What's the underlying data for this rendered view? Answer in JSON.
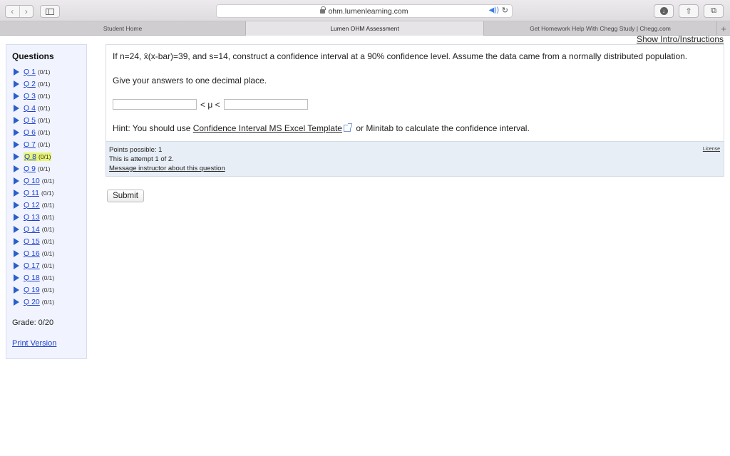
{
  "browser": {
    "url": "ohm.lumenlearning.com",
    "back_glyph": "‹",
    "forward_glyph": "›",
    "audio_glyph": "◀))",
    "reload_glyph": "↻",
    "download_glyph": "↓",
    "share_glyph": "⇧",
    "tabs_glyph": "⧉",
    "new_tab_glyph": "+",
    "tabs": [
      {
        "label": "Student Home"
      },
      {
        "label": "Lumen OHM Assessment"
      },
      {
        "label": "Get Homework Help With Chegg Study | Chegg.com"
      }
    ]
  },
  "page": {
    "show_intro": "Show Intro/Instructions"
  },
  "sidebar": {
    "title": "Questions",
    "items": [
      {
        "label": "Q 1",
        "score": "(0/1)"
      },
      {
        "label": "Q 2",
        "score": "(0/1)"
      },
      {
        "label": "Q 3",
        "score": "(0/1)"
      },
      {
        "label": "Q 4",
        "score": "(0/1)"
      },
      {
        "label": "Q 5",
        "score": "(0/1)"
      },
      {
        "label": "Q 6",
        "score": "(0/1)"
      },
      {
        "label": "Q 7",
        "score": "(0/1)"
      },
      {
        "label": "Q 8",
        "score": "(0/1)"
      },
      {
        "label": "Q 9",
        "score": "(0/1)"
      },
      {
        "label": "Q 10",
        "score": "(0/1)"
      },
      {
        "label": "Q 11",
        "score": "(0/1)"
      },
      {
        "label": "Q 12",
        "score": "(0/1)"
      },
      {
        "label": "Q 13",
        "score": "(0/1)"
      },
      {
        "label": "Q 14",
        "score": "(0/1)"
      },
      {
        "label": "Q 15",
        "score": "(0/1)"
      },
      {
        "label": "Q 16",
        "score": "(0/1)"
      },
      {
        "label": "Q 17",
        "score": "(0/1)"
      },
      {
        "label": "Q 18",
        "score": "(0/1)"
      },
      {
        "label": "Q 19",
        "score": "(0/1)"
      },
      {
        "label": "Q 20",
        "score": "(0/1)"
      }
    ],
    "grade": "Grade: 0/20",
    "print_version": "Print Version"
  },
  "question": {
    "text": "If n=24, x̄(x-bar)=39, and s=14, construct a confidence interval at a 90% confidence level. Assume the data came from a normally distributed population.",
    "instruction": "Give your answers to one decimal place.",
    "lower_value": "",
    "upper_value": "",
    "mu_label": "< μ <",
    "hint_prefix": "Hint: You should use ",
    "hint_link": "Confidence Interval MS Excel Template",
    "hint_suffix": " or Minitab to calculate the confidence interval."
  },
  "info": {
    "points": "Points possible: 1",
    "attempt": "This is attempt 1 of 2.",
    "message": "Message instructor about this question",
    "license": "License"
  },
  "submit_label": "Submit",
  "colors": {
    "link": "#1a3fd0",
    "current_highlight": "#e8f572",
    "arrow": "#2a5fc9",
    "panel_bg": "#f1f4ff",
    "info_bg": "#e7eef6"
  }
}
